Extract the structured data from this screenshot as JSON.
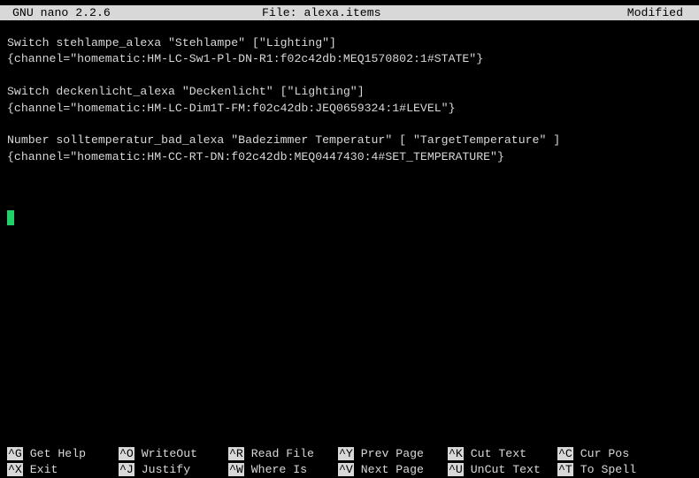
{
  "header": {
    "version": "GNU nano 2.2.6",
    "file": "File: alexa.items",
    "status": "Modified"
  },
  "lines": [
    "Switch stehlampe_alexa \"Stehlampe\" [\"Lighting\"]",
    "{channel=\"homematic:HM-LC-Sw1-Pl-DN-R1:f02c42db:MEQ1570802:1#STATE\"}",
    "",
    "Switch deckenlicht_alexa \"Deckenlicht\" [\"Lighting\"]",
    "{channel=\"homematic:HM-LC-Dim1T-FM:f02c42db:JEQ0659324:1#LEVEL\"}",
    "",
    "Number solltemperatur_bad_alexa \"Badezimmer Temperatur\" [ \"TargetTemperature\" ]",
    "{channel=\"homematic:HM-CC-RT-DN:f02c42db:MEQ0447430:4#SET_TEMPERATURE\"}"
  ],
  "shortcuts": {
    "row1": [
      {
        "key": "^G",
        "label": " Get Help"
      },
      {
        "key": "^O",
        "label": " WriteOut"
      },
      {
        "key": "^R",
        "label": " Read File"
      },
      {
        "key": "^Y",
        "label": " Prev Page"
      },
      {
        "key": "^K",
        "label": " Cut Text"
      },
      {
        "key": "^C",
        "label": " Cur Pos"
      }
    ],
    "row2": [
      {
        "key": "^X",
        "label": " Exit"
      },
      {
        "key": "^J",
        "label": " Justify"
      },
      {
        "key": "^W",
        "label": " Where Is"
      },
      {
        "key": "^V",
        "label": " Next Page"
      },
      {
        "key": "^U",
        "label": " UnCut Text"
      },
      {
        "key": "^T",
        "label": " To Spell"
      }
    ]
  },
  "colors": {
    "background": "#000000",
    "text": "#d8d8d8",
    "inverse_bg": "#d8d8d8",
    "cursor": "#22d06a"
  }
}
